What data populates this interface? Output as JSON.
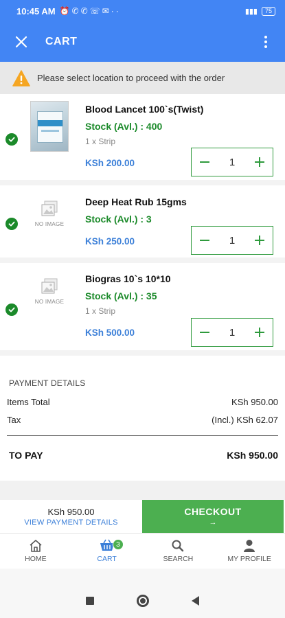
{
  "status_bar": {
    "time": "10:45 AM",
    "battery": "75"
  },
  "app_bar": {
    "title": "CART"
  },
  "warning": {
    "text": "Please select location to proceed with the order"
  },
  "cart": {
    "items": [
      {
        "name": "Blood Lancet 100`s(Twist)",
        "stock": "Stock (Avl.) : 400",
        "pack": "1 x Strip",
        "price": "KSh 200.00",
        "qty": "1",
        "image": "product-photo"
      },
      {
        "name": "Deep Heat Rub 15gms",
        "stock": "Stock (Avl.) : 3",
        "pack": "",
        "price": "KSh 250.00",
        "qty": "1",
        "image": "no-image",
        "no_image_label": "NO IMAGE"
      },
      {
        "name": "Biogras 10`s 10*10",
        "stock": "Stock (Avl.) : 35",
        "pack": "1 x Strip",
        "price": "KSh 500.00",
        "qty": "1",
        "image": "no-image",
        "no_image_label": "NO IMAGE"
      }
    ]
  },
  "payment": {
    "title": "PAYMENT DETAILS",
    "items_total_label": "Items Total",
    "items_total_value": "KSh 950.00",
    "tax_label": "Tax",
    "tax_value": "(Incl.) KSh 62.07",
    "to_pay_label": "TO PAY",
    "to_pay_value": "KSh 950.00"
  },
  "checkout_bar": {
    "total": "KSh 950.00",
    "view_details": "VIEW PAYMENT DETAILS",
    "checkout_label": "CHECKOUT",
    "checkout_arrow": "→"
  },
  "bottom_nav": {
    "items": [
      {
        "label": "HOME",
        "icon": "home-icon"
      },
      {
        "label": "CART",
        "icon": "cart-icon",
        "badge": "3"
      },
      {
        "label": "SEARCH",
        "icon": "search-icon"
      },
      {
        "label": "MY PROFILE",
        "icon": "profile-icon"
      }
    ]
  },
  "colors": {
    "primary": "#4285f4",
    "stock_green": "#1b8a2a",
    "price_blue": "#3b7fd8",
    "checkout_green": "#4caf50",
    "warning_orange": "#f5a623"
  }
}
